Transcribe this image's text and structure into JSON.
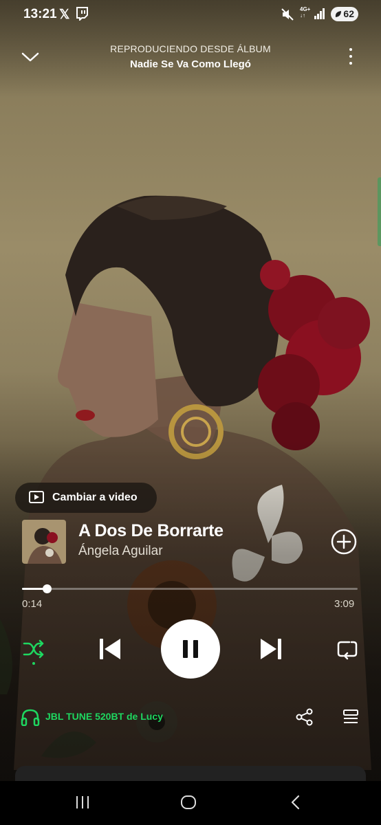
{
  "status_bar": {
    "time": "13:21",
    "x_icon": "x-logo-icon",
    "net_label_top": "4G+",
    "net_label_bottom": "↓↑",
    "battery": "62"
  },
  "header": {
    "source_label": "REPRODUCIENDO DESDE ÁLBUM",
    "album_name": "Nadie Se Va Como Llegó"
  },
  "video_toggle": {
    "label": "Cambiar a video"
  },
  "track": {
    "title": "A Dos De Borrarte",
    "artist": "Ángela Aguilar"
  },
  "playback": {
    "elapsed": "0:14",
    "total": "3:09",
    "progress": 0.074,
    "state": "playing"
  },
  "device": {
    "label": "JBL TUNE 520BT de Lucy"
  },
  "colors": {
    "accent_green": "#1ed760",
    "play_button": "#ffffff",
    "flower_red": "#8a1020"
  },
  "icons": {
    "collapse": "chevron-down-icon",
    "more": "more-vertical-icon",
    "video": "video-play-icon",
    "add": "add-circle-icon",
    "shuffle": "shuffle-icon",
    "previous": "skip-previous-icon",
    "pause": "pause-icon",
    "next": "skip-next-icon",
    "repeat": "repeat-icon",
    "device": "headphones-icon",
    "share": "share-icon",
    "queue": "queue-icon"
  }
}
